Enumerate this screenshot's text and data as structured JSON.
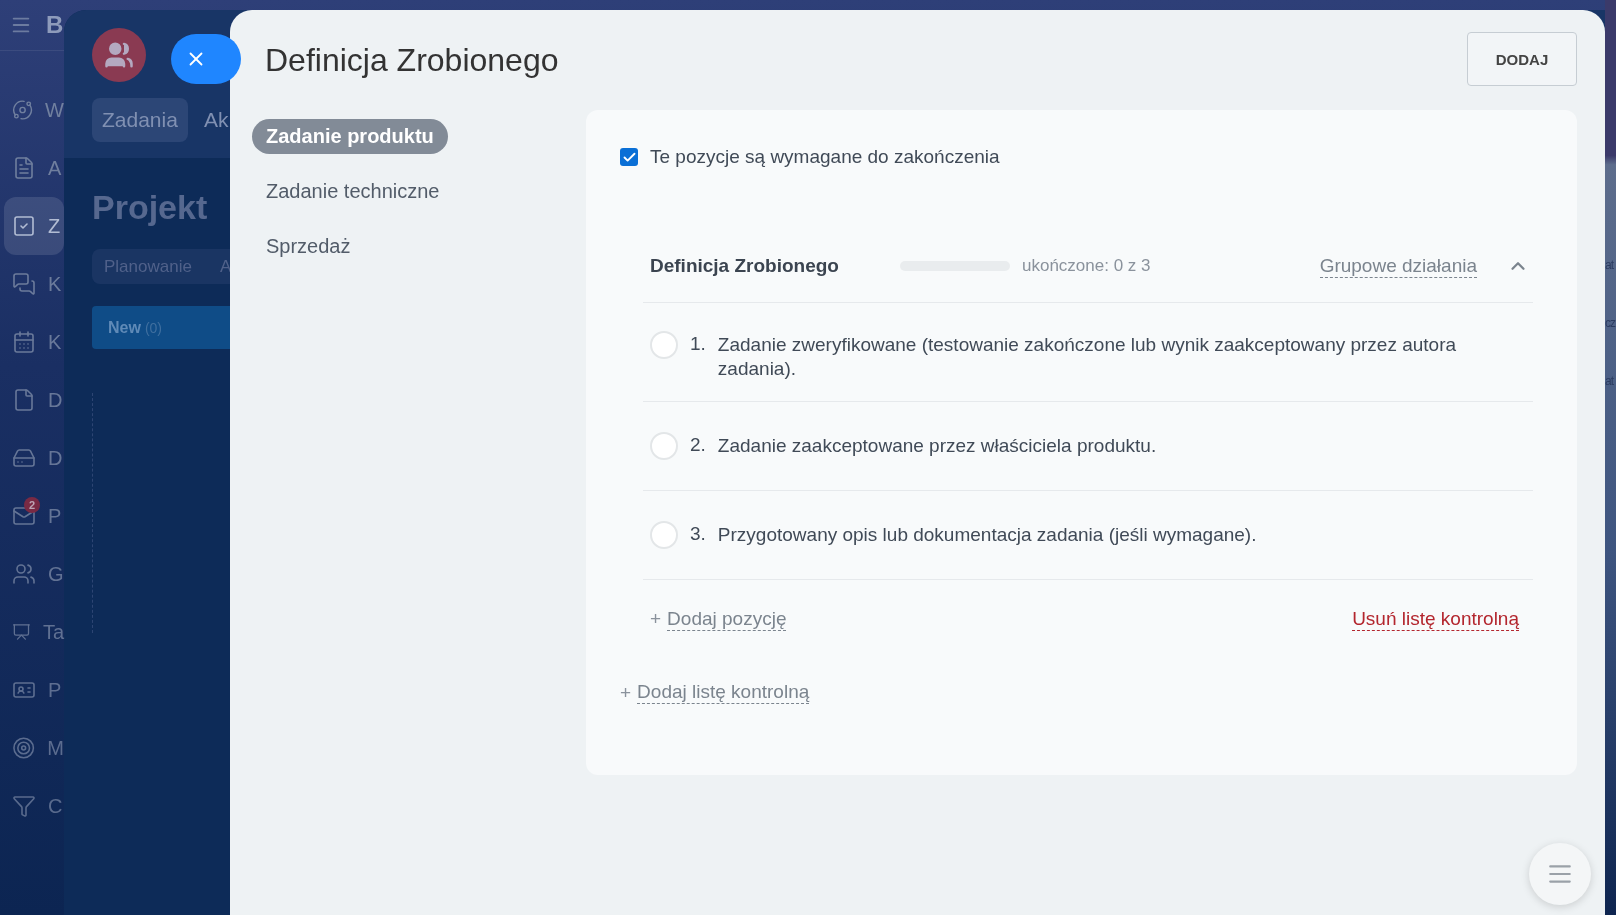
{
  "background": {
    "logo": "B",
    "sidebar": [
      {
        "label": "W",
        "selected": false
      },
      {
        "label": "A",
        "selected": false
      },
      {
        "label": "Z",
        "selected": true
      },
      {
        "label": "K",
        "selected": false
      },
      {
        "label": "K",
        "selected": false
      },
      {
        "label": "D",
        "selected": false
      },
      {
        "label": "D",
        "selected": false
      },
      {
        "label": "P",
        "selected": false,
        "badge": "2"
      },
      {
        "label": "G",
        "selected": false
      },
      {
        "label": "Ta",
        "selected": false
      },
      {
        "label": "P",
        "selected": false
      },
      {
        "label": "M",
        "selected": false
      },
      {
        "label": "C",
        "selected": false
      }
    ],
    "tabs": [
      {
        "label": "Zadania",
        "selected": true
      },
      {
        "label": "Ak",
        "selected": false
      }
    ],
    "title": "Projekt",
    "views": [
      "Planowanie",
      "A"
    ],
    "column": {
      "title": "New",
      "count": "(0)"
    },
    "right_edge": [
      "at",
      "cz",
      "at"
    ]
  },
  "modal": {
    "title": "Definicja Zrobionego",
    "add_button": "DODAJ",
    "nav": [
      {
        "label": "Zadanie produktu",
        "selected": true
      },
      {
        "label": "Zadanie techniczne",
        "selected": false
      },
      {
        "label": "Sprzedaż",
        "selected": false
      }
    ],
    "required": {
      "label": "Te pozycje są wymagane do zakończenia",
      "checked": true
    },
    "checklist": {
      "title": "Definicja Zrobionego",
      "progress": {
        "level": 0,
        "text": "ukończone: 0 z 3"
      },
      "group_actions": "Grupowe działania",
      "expanded": true,
      "items": [
        {
          "number": "1.",
          "text": "Zadanie zweryfikowane (testowanie zakończone lub wynik zaakceptowany przez autora zadania).",
          "checked": false
        },
        {
          "number": "2.",
          "text": "Zadanie zaakceptowane przez właściciela produktu.",
          "checked": false
        },
        {
          "number": "3.",
          "text": "Przygotowany opis lub dokumentacja zadania (jeśli wymagane).",
          "checked": false
        }
      ],
      "add_item": {
        "icon": "+",
        "label": "Dodaj pozycję"
      },
      "delete": "Usuń listę kontrolną"
    },
    "add_checklist": {
      "icon": "+",
      "label": "Dodaj listę kontrolną"
    }
  }
}
